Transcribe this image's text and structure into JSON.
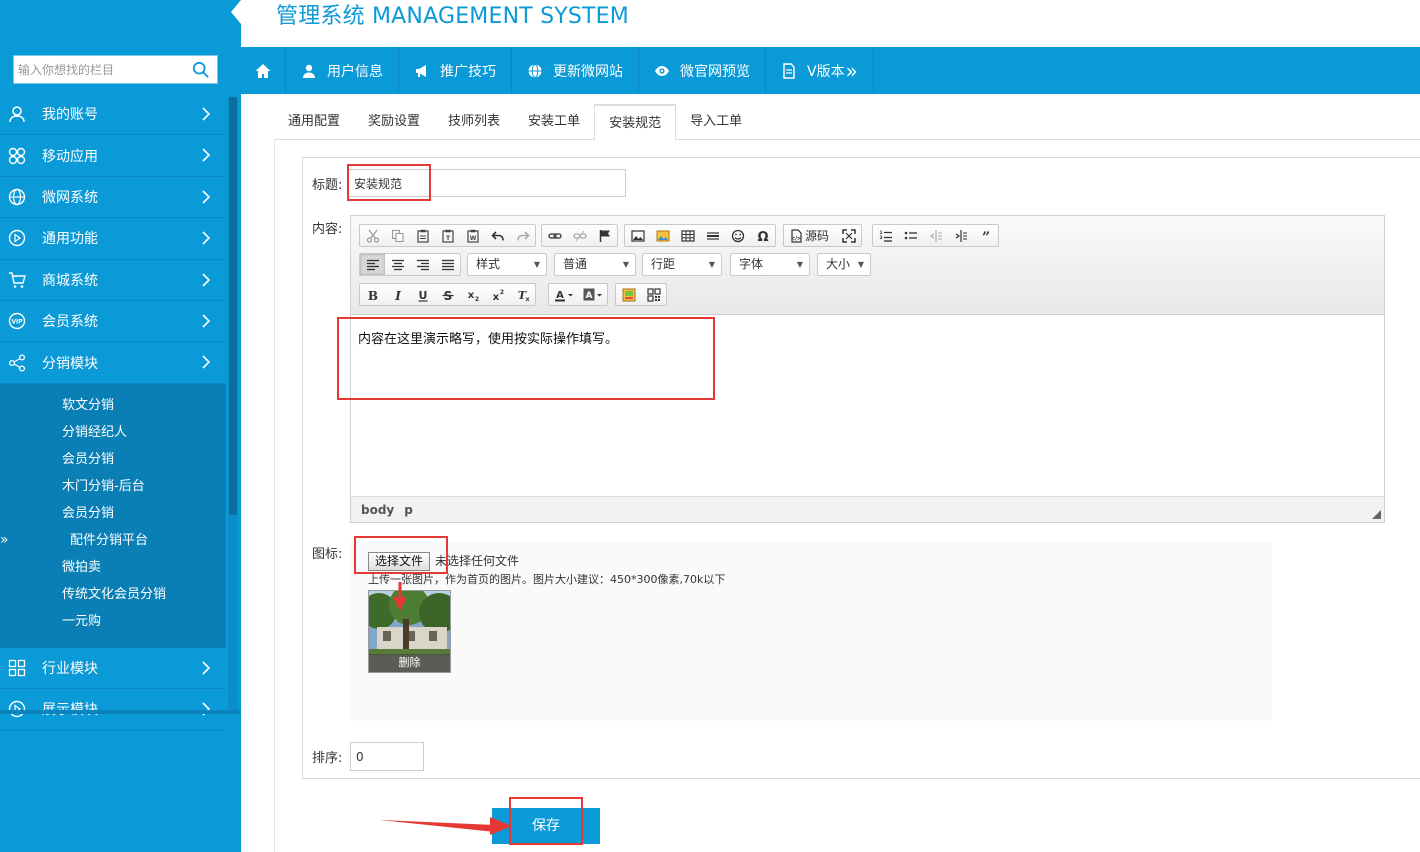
{
  "app": {
    "brand_title": "管理系统 MANAGEMENT SYSTEM"
  },
  "colors": {
    "primary": "#0a9ad7",
    "annotation": "#e53935"
  },
  "sidebar": {
    "search_placeholder": "输入你想找的栏目",
    "items": [
      {
        "label": "我的账号",
        "icon": "user-icon"
      },
      {
        "label": "移动应用",
        "icon": "apps-icon"
      },
      {
        "label": "微网系统",
        "icon": "globe-icon"
      },
      {
        "label": "通用功能",
        "icon": "play-circle-icon"
      },
      {
        "label": "商城系统",
        "icon": "cart-icon"
      },
      {
        "label": "会员系统",
        "icon": "vip-icon"
      },
      {
        "label": "分销模块",
        "icon": "share-icon"
      },
      {
        "label": "行业模块",
        "icon": "grid-icon"
      },
      {
        "label": "展示模块",
        "icon": "play-circle-icon"
      }
    ],
    "submenu": [
      {
        "label": "软文分销"
      },
      {
        "label": "分销经纪人"
      },
      {
        "label": "会员分销"
      },
      {
        "label": "木门分销-后台"
      },
      {
        "label": "会员分销"
      },
      {
        "label": "配件分销平台",
        "active": true
      },
      {
        "label": "微拍卖"
      },
      {
        "label": "传统文化会员分销"
      },
      {
        "label": "一元购"
      }
    ],
    "active_marker": "»"
  },
  "topnav": {
    "items": [
      {
        "label": "用户信息",
        "icon": "user-icon"
      },
      {
        "label": "推广技巧",
        "icon": "megaphone-icon"
      },
      {
        "label": "更新微网站",
        "icon": "globe-icon"
      },
      {
        "label": "微官网预览",
        "icon": "eye-icon"
      },
      {
        "label": "V版本",
        "icon": "document-icon",
        "suffix": "»"
      }
    ]
  },
  "tabs": [
    {
      "label": "通用配置"
    },
    {
      "label": "奖励设置"
    },
    {
      "label": "技师列表"
    },
    {
      "label": "安装工单"
    },
    {
      "label": "安装规范",
      "active": true
    },
    {
      "label": "导入工单"
    }
  ],
  "form": {
    "title_label": "标题:",
    "title_value": "安装规范",
    "content_label": "内容:",
    "content_text": "内容在这里演示略写，使用按实际操作填写。",
    "icon_label": "图标:",
    "sort_label": "排序:",
    "sort_value": "0",
    "save_label": "保存"
  },
  "editor": {
    "source_label": "源码",
    "combos": [
      {
        "label": "样式"
      },
      {
        "label": "普通"
      },
      {
        "label": "行距"
      },
      {
        "label": "字体"
      },
      {
        "label": "大小"
      }
    ],
    "path": [
      "body",
      "p"
    ]
  },
  "upload": {
    "button_label": "选择文件",
    "status": "未选择任何文件",
    "hint": "上传一张图片，作为首页的图片。图片大小建议：450*300像素,70k以下",
    "thumb_caption": "删除"
  }
}
